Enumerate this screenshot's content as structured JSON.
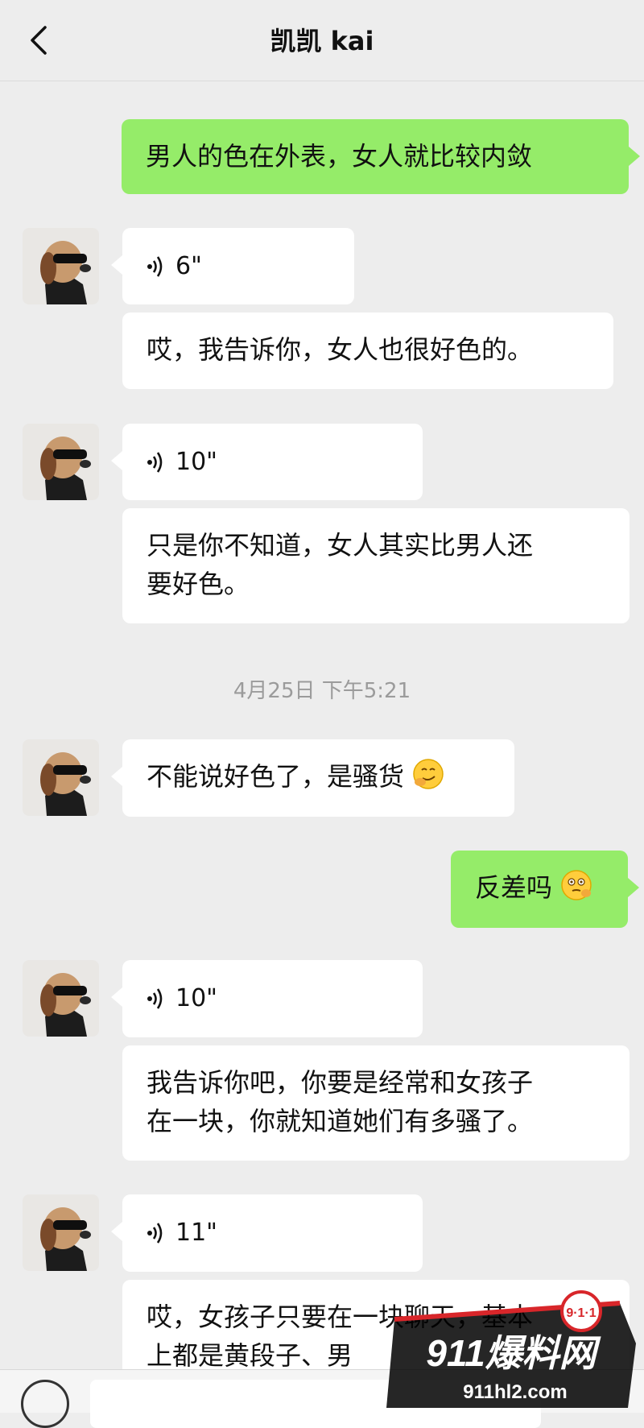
{
  "header": {
    "title": "凯凯 kai"
  },
  "messages": [
    {
      "text": "男人的色在外表，女人就比较内敛"
    },
    {
      "duration": "6\""
    },
    {
      "text": "哎，我告诉你，女人也很好色的。"
    },
    {
      "duration": "10\""
    },
    {
      "lines": [
        "只是你不知道，女人其实比男人还",
        "要好色。"
      ]
    },
    {
      "text": "不能说好色了，是骚货"
    },
    {
      "text": "反差吗"
    },
    {
      "duration": "10\""
    },
    {
      "lines": [
        "我告诉你吧，你要是经常和女孩子",
        "在一块，你就知道她们有多骚了。"
      ]
    },
    {
      "duration": "11\""
    },
    {
      "lines": [
        "哎，女孩子只要在一块聊天，基本",
        "上都是黄段子、男"
      ]
    }
  ],
  "timestamp": "4月25日 下午5:21",
  "watermark": {
    "brand": "911爆料网",
    "url": "911hl2.com",
    "badge": "9·1·1"
  },
  "colors": {
    "background": "#ededed",
    "sent_bubble": "#95ec69",
    "received_bubble": "#ffffff"
  }
}
